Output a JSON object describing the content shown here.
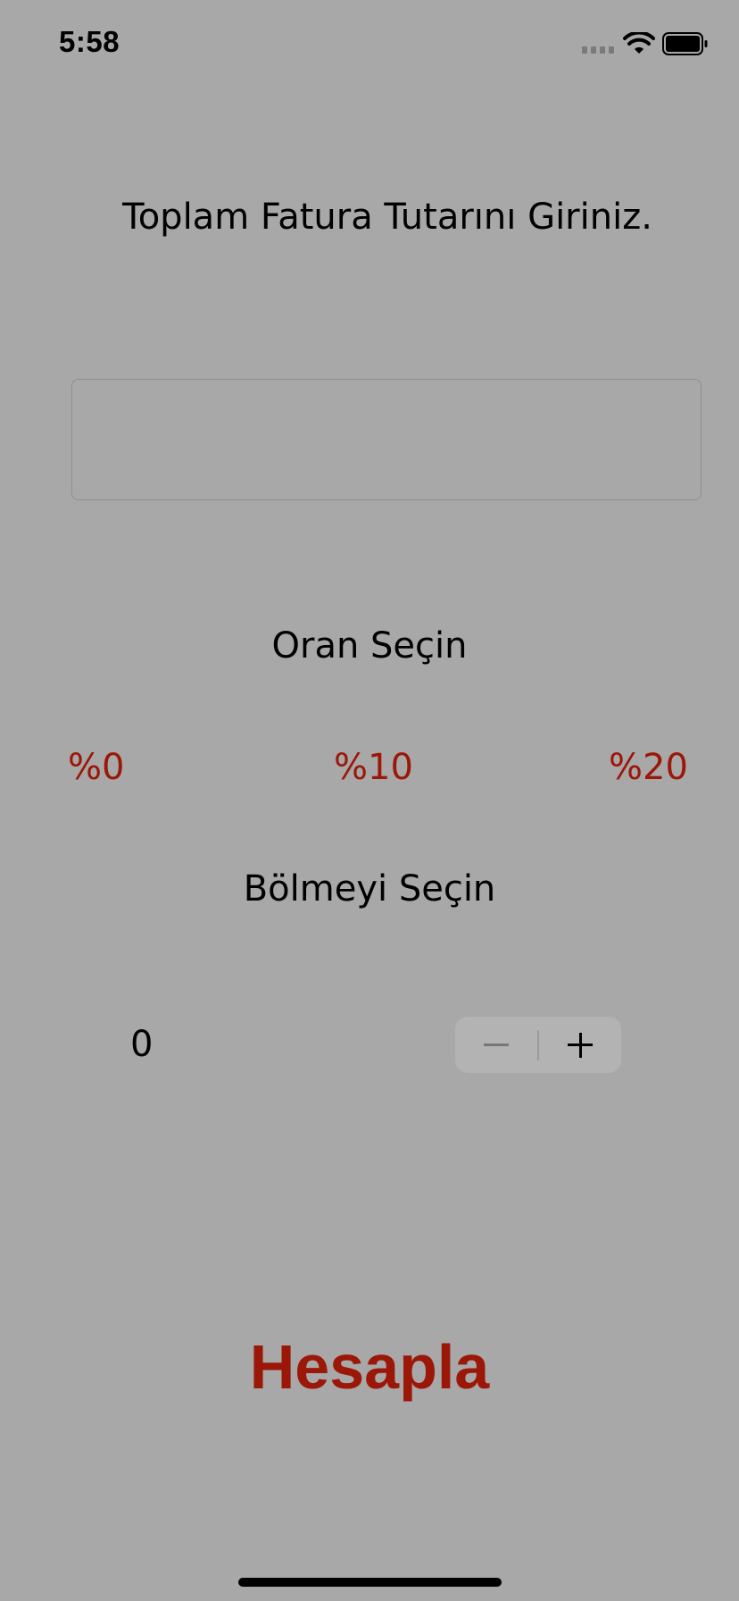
{
  "status_bar": {
    "time": "5:58",
    "icons": [
      "cellular-signal-icon",
      "wifi-icon",
      "battery-icon"
    ]
  },
  "form": {
    "instruction": "Toplam Fatura Tutarını Giriniz.",
    "amount_value": "",
    "rate_title": "Oran Seçin",
    "rate_options": [
      "%0",
      "%10",
      "%20"
    ],
    "split_title": "Bölmeyi Seçin",
    "split_value": "0",
    "calculate_label": "Hesapla"
  },
  "colors": {
    "background": "#a8a8a8",
    "accent": "#9b1708"
  }
}
